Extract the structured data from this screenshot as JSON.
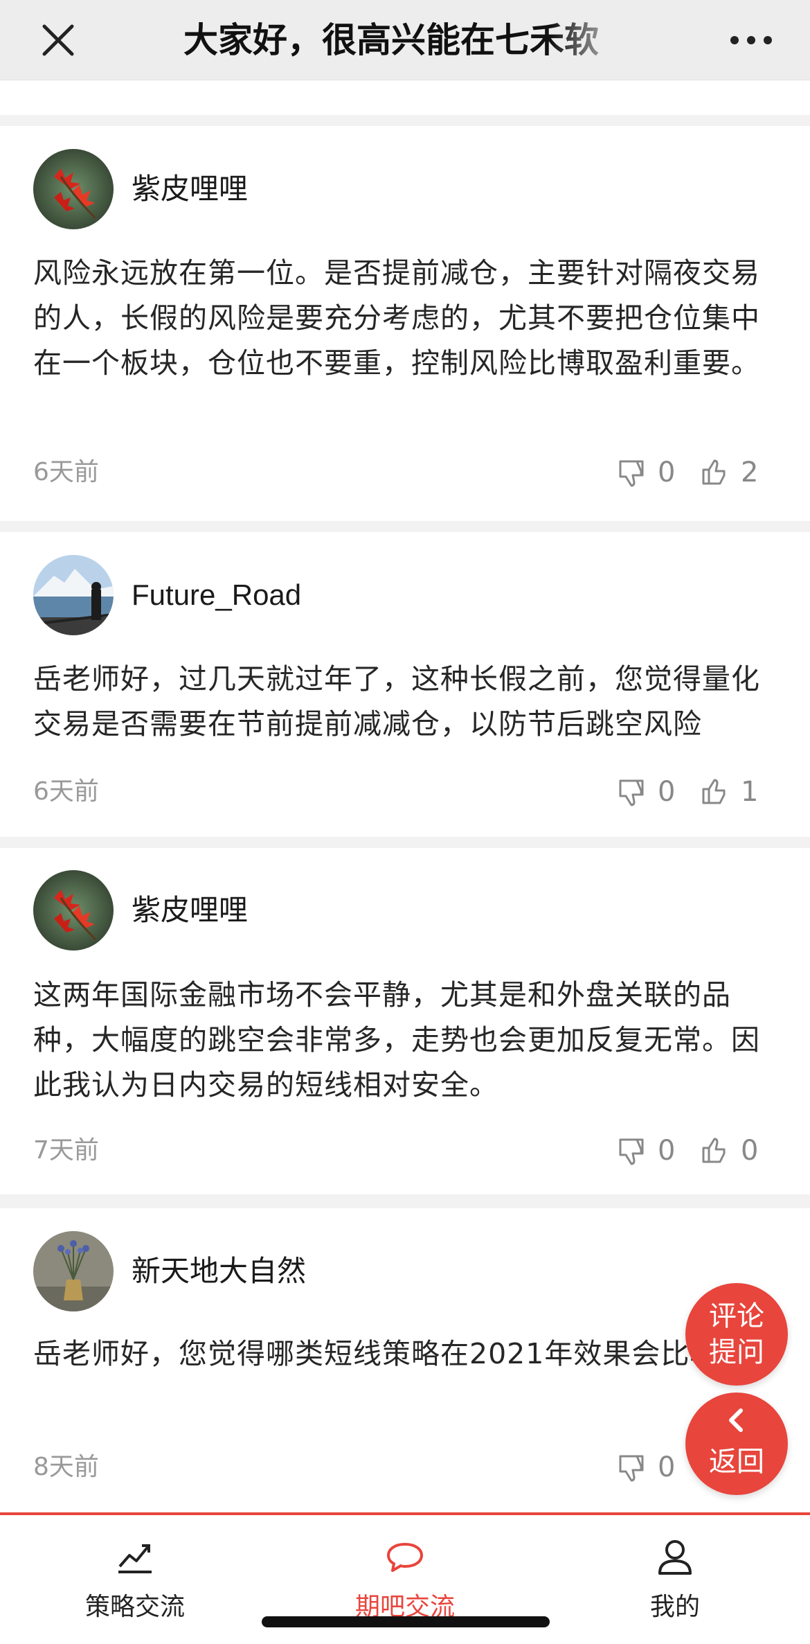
{
  "header": {
    "title": "大家好，很高兴能在七禾软",
    "close_icon": "close-icon",
    "more_icon": "more-horizontal-icon"
  },
  "comments": [
    {
      "username": "紫皮哩哩",
      "avatar": "red-maple-leaves-avatar",
      "text": "风险永远放在第一位。是否提前减仓，主要针对隔夜交易的人，长假的风险是要充分考虑的，尤其不要把仓位集中在一个板块，仓位也不要重，控制风险比博取盈利重要。",
      "time": "6天前",
      "dislikes": "0",
      "likes": "2"
    },
    {
      "username": "Future_Road",
      "avatar": "lake-mountain-avatar",
      "text": "岳老师好，过几天就过年了，这种长假之前，您觉得量化交易是否需要在节前提前减减仓，以防节后跳空风险",
      "time": "6天前",
      "dislikes": "0",
      "likes": "1"
    },
    {
      "username": "紫皮哩哩",
      "avatar": "red-maple-leaves-avatar",
      "text": "这两年国际金融市场不会平静，尤其是和外盘关联的品种，大幅度的跳空会非常多，走势也会更加反复无常。因此我认为日内交易的短线相对安全。",
      "time": "7天前",
      "dislikes": "0",
      "likes": "0"
    },
    {
      "username": "新天地大自然",
      "avatar": "lavender-vase-avatar",
      "text": "岳老师好，您觉得哪类短线策略在2021年效果会比较好?",
      "time": "8天前",
      "dislikes": "0",
      "likes": ""
    }
  ],
  "fab": {
    "comment_line1": "评论",
    "comment_line2": "提问",
    "back_icon": "chevron-left-icon",
    "back_label": "返回"
  },
  "tabs": [
    {
      "label": "策略交流",
      "icon": "trend-chart-icon",
      "active": false
    },
    {
      "label": "期吧交流",
      "icon": "chat-bubble-icon",
      "active": true
    },
    {
      "label": "我的",
      "icon": "person-icon",
      "active": false
    }
  ],
  "colors": {
    "accent": "#e8453c",
    "muted_text": "#999999",
    "background": "#f2f2f2"
  }
}
